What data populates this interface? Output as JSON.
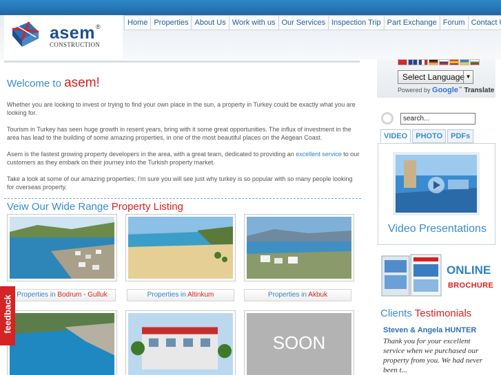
{
  "header": {
    "logo_word": "asem",
    "logo_reg": "®",
    "logo_sub": "CONSTRUCTION"
  },
  "nav": {
    "items": [
      "Home",
      "Properties",
      "About Us",
      "Work with us",
      "Our Services",
      "Inspection Trip",
      "Part Exchange",
      "Forum",
      "Contact Us"
    ]
  },
  "main": {
    "welcome_prefix": "Welcome to ",
    "welcome_brand": "asem!",
    "para1": "Whether you are looking to invest or trying to find your own place in the sun, a property in Turkey could be exactly what you are looking for.",
    "para2": "Tourism in Turkey has seen huge growth in resent years, bring with it some great opportunities. The influx of investment in the area has lead to the building of some amazing properties, in one of the most beautiful places on the Aegean Coast.",
    "para3_before": "Asem is the fastest growing property developers in the area, with a great team, dedicated to providing an ",
    "para3_link": "excellent service",
    "para3_after": " to our customers as they embark on their journey into the Turkish property market.",
    "para4": "Take a look at some of our amazing properties; I'm sure you will see just why turkey is so popular with so many people looking for overseas property.",
    "section_title_blue": "Veiw Our Wide Range ",
    "section_title_red": "Property Listing",
    "properties": [
      {
        "prefix": "Properties in ",
        "place": "Bodrum - Gulluk"
      },
      {
        "prefix": "Properties in ",
        "place": "Altinkum"
      },
      {
        "prefix": "Properties in ",
        "place": "Akbuk"
      }
    ],
    "soon_text": "SOON"
  },
  "feedback_label": "feedback",
  "sidebar": {
    "select_language": "Select Language",
    "powered_by": "Powered by ",
    "google": "Google",
    "translate": "Translate",
    "search_value": "search...",
    "tabs": [
      "VIDEO",
      "PHOTO",
      "PDFs"
    ],
    "video_title": "Video Presentations",
    "online": "ONLINE",
    "brochure": "BROCHURE",
    "testimonials_blue": "Clients ",
    "testimonials_red": "Testimonials",
    "testimonial_author": "Steven & Angela HUNTER",
    "testimonial_text": "Thank you for your excellent service when we purchased our property from you. We had never been t..."
  },
  "colors": {
    "accent_blue": "#3a8ad0",
    "accent_red": "#d72020",
    "topbar": "#2f86c6"
  }
}
